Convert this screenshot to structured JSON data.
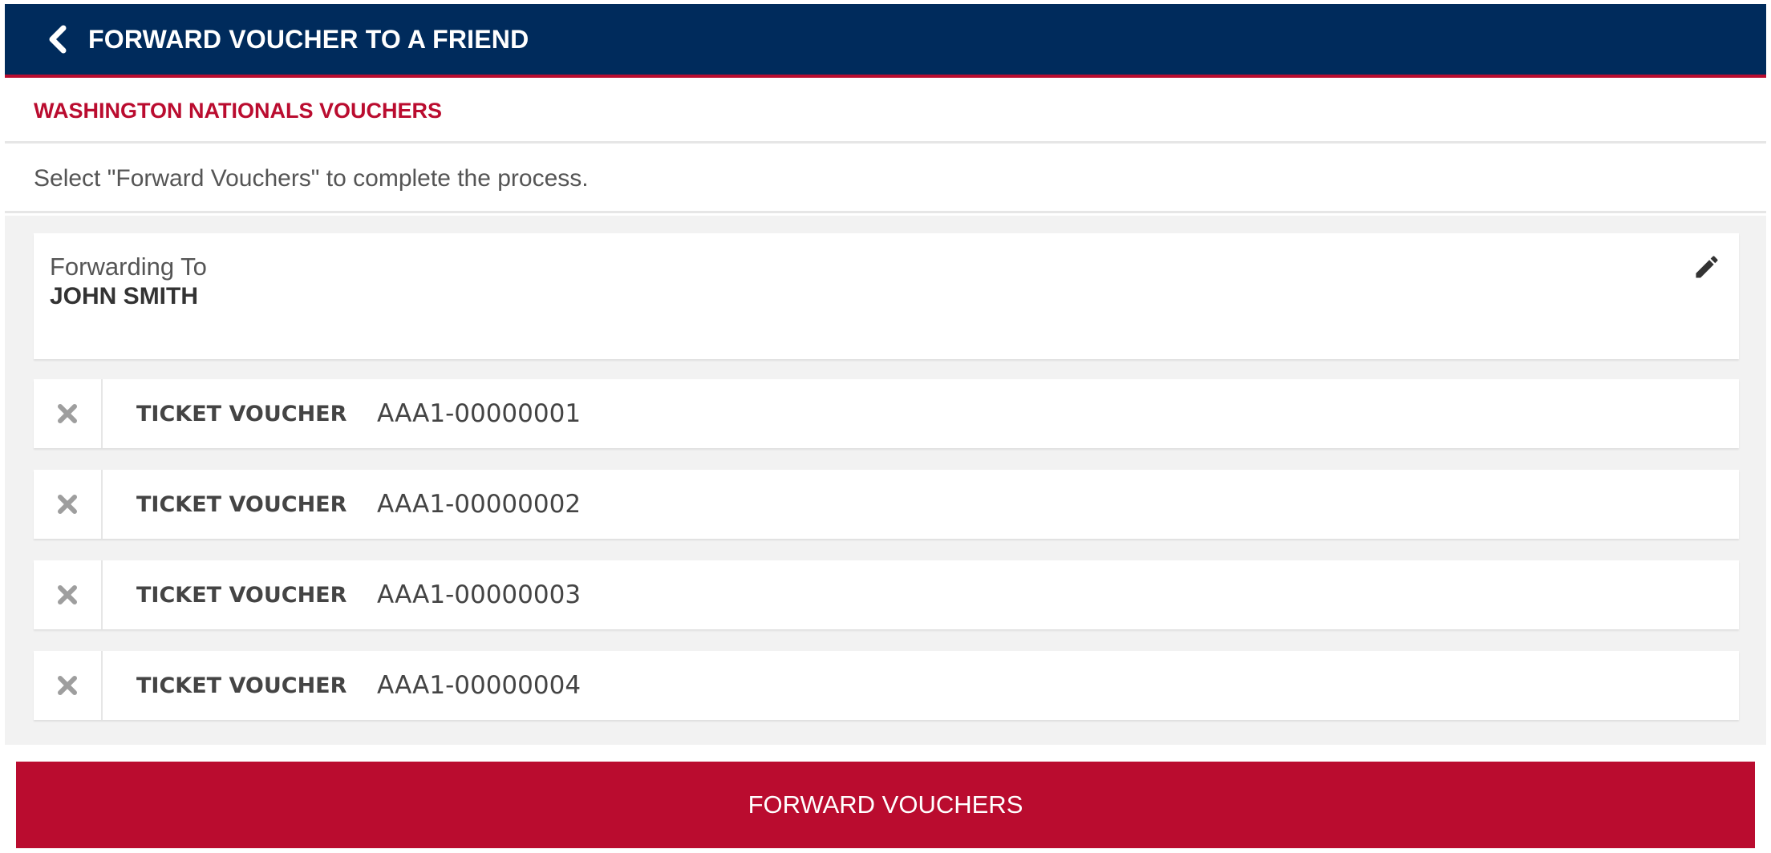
{
  "header": {
    "back_icon": "chevron-left-icon",
    "title": "FORWARD VOUCHER TO A FRIEND"
  },
  "subhead": {
    "title": "WASHINGTON NATIONALS VOUCHERS"
  },
  "instruction": {
    "text": "Select \"Forward Vouchers\" to complete the process."
  },
  "recipient": {
    "label": "Forwarding To",
    "name": "JOHN SMITH",
    "edit_icon": "pencil-icon"
  },
  "vouchers": [
    {
      "type": "TICKET VOUCHER",
      "code": "AAA1-00000001"
    },
    {
      "type": "TICKET VOUCHER",
      "code": "AAA1-00000002"
    },
    {
      "type": "TICKET VOUCHER",
      "code": "AAA1-00000003"
    },
    {
      "type": "TICKET VOUCHER",
      "code": "AAA1-00000004"
    }
  ],
  "remove_icon": "close-icon",
  "forward_button": {
    "label": "FORWARD VOUCHERS"
  },
  "colors": {
    "header_bg": "#002b5c",
    "accent_red": "#ba0c2f",
    "panel_bg": "#f2f2f2"
  }
}
